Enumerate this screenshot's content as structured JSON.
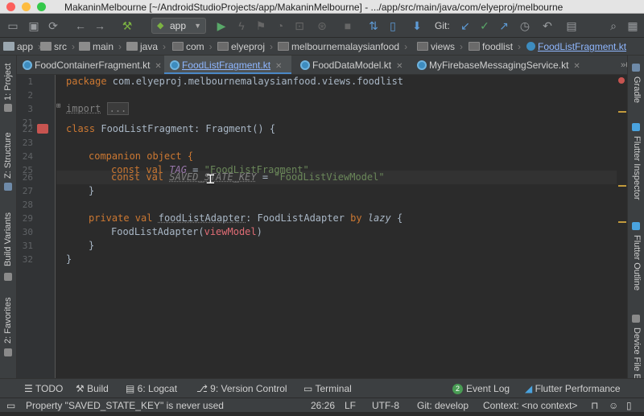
{
  "window": {
    "title": "MakaninMelbourne [~/AndroidStudioProjects/app/MakaninMelbourne] - .../app/src/main/java/com/elyeproj/melbourne"
  },
  "toolbar": {
    "run_config": "app",
    "git_label": "Git:"
  },
  "breadcrumbs": [
    {
      "label": "app",
      "icon": "module-folder-icon"
    },
    {
      "label": "src",
      "icon": "folder-icon"
    },
    {
      "label": "main",
      "icon": "folder-icon"
    },
    {
      "label": "java",
      "icon": "folder-icon"
    },
    {
      "label": "com",
      "icon": "package-icon"
    },
    {
      "label": "elyeproj",
      "icon": "package-icon"
    },
    {
      "label": "melbournemalaysianfood",
      "icon": "package-icon"
    },
    {
      "label": "views",
      "icon": "package-icon"
    },
    {
      "label": "foodlist",
      "icon": "package-icon"
    },
    {
      "label": "FoodListFragment.kt",
      "icon": "kotlin-file-icon"
    }
  ],
  "tabs": [
    {
      "label": "FoodContainerFragment.kt",
      "active": false
    },
    {
      "label": "FoodListFragment.kt",
      "active": true
    },
    {
      "label": "FoodDataModel.kt",
      "active": false
    },
    {
      "label": "MyFirebaseMessagingService.kt",
      "active": false
    }
  ],
  "tab_overflow": "6",
  "left_tools": [
    {
      "label": "1: Project"
    },
    {
      "label": "Z: Structure"
    },
    {
      "label": "Build Variants"
    },
    {
      "label": "2: Favorites"
    }
  ],
  "right_tools": [
    {
      "label": "Gradle"
    },
    {
      "label": "Flutter Inspector"
    },
    {
      "label": "Flutter Outline"
    },
    {
      "label": "Device File E"
    }
  ],
  "code": {
    "line_numbers": [
      "1",
      "2",
      "3",
      "21",
      "22",
      "23",
      "24",
      "25",
      "26",
      "27",
      "28",
      "29",
      "30",
      "31",
      "32"
    ],
    "package_kw": "package",
    "package_name": " com.elyeproj.melbournemalaysianfood.views.foodlist",
    "import_kw": "import",
    "import_fold": "...",
    "class_kw": "class",
    "class_decl": " FoodListFragment: Fragment() {",
    "companion": "companion object {",
    "const_val": "const val",
    "tag_name": "TAG",
    "eq": " = ",
    "tag_value": "\"FoodListFragment\"",
    "key_name": "SAVED_STATE_KEY",
    "key_value": "\"FoodListViewModel\"",
    "close_brace": "}",
    "private_val": "private val",
    "adapter_name": "foodListAdapter",
    "adapter_type": ": FoodListAdapter ",
    "by_kw": "by",
    "lazy_kw": "lazy",
    "open_brace": " {",
    "adapter_call_head": "FoodListAdapter(",
    "adapter_call_arg": "viewModel",
    "adapter_call_tail": ")"
  },
  "bottom_tools": [
    {
      "label": "TODO",
      "icon": "list-icon"
    },
    {
      "label": "Build",
      "icon": "hammer-icon"
    },
    {
      "label": "6: Logcat",
      "icon": "logcat-icon"
    },
    {
      "label": "9: Version Control",
      "icon": "vcs-icon"
    },
    {
      "label": "Terminal",
      "icon": "terminal-icon"
    },
    {
      "label": "Event Log",
      "badge": "2"
    },
    {
      "label": "Flutter Performance",
      "icon": "flutter-icon"
    }
  ],
  "status": {
    "message": "Property \"SAVED_STATE_KEY\" is never used",
    "position": "26:26",
    "line_sep": "LF",
    "encoding": "UTF-8",
    "git_branch": "Git: develop",
    "context": "Context: <no context>"
  },
  "colors": {
    "editor_bg": "#2b2b2b",
    "keyword": "#cc7832",
    "string": "#6a8759",
    "property": "#9876aa",
    "accent": "#4a88c7"
  }
}
